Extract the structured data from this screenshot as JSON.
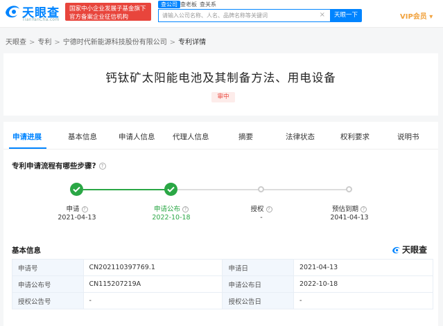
{
  "header": {
    "logo_cn": "天眼查",
    "logo_en": "TianYanCha.com",
    "promo_line1": "国家中小企业发展子基金旗下",
    "promo_line2": "官方备案企业征信机构",
    "search_tabs": [
      "查公司",
      "查老板",
      "查关系"
    ],
    "search_placeholder": "请输入公司名称、人名、品牌名称等关键词",
    "clear_glyph": "×",
    "search_button": "天眼一下",
    "vip": "VIP会员 ▾",
    "colors": {
      "brand": "#0084ff",
      "promo": "#e8453c",
      "vip": "#f1a23d"
    }
  },
  "breadcrumb": [
    "天眼查",
    "专利",
    "宁德时代新能源科技股份有限公司",
    "专利详情"
  ],
  "patent": {
    "title": "钙钛矿太阳能电池及其制备方法、用电设备",
    "status": "审中"
  },
  "tabs": [
    "申请进展",
    "基本信息",
    "申请人信息",
    "代理人信息",
    "摘要",
    "法律状态",
    "权利要求",
    "说明书"
  ],
  "progress": {
    "question": "专利申请流程有哪些步骤?",
    "steps": [
      {
        "name": "申请",
        "date": "2021-04-13",
        "done": true
      },
      {
        "name": "申请公布",
        "date": "2022-10-18",
        "done": true
      },
      {
        "name": "授权",
        "date": "-",
        "done": false
      },
      {
        "name": "预估到期",
        "date": "2041-04-13",
        "done": false
      }
    ],
    "colors": {
      "done": "#2aa745",
      "todo": "#cccccc"
    }
  },
  "basic": {
    "title": "基本信息",
    "brand": "天眼查",
    "rows": [
      [
        "申请号",
        "CN202110397769.1",
        "申请日",
        "2021-04-13"
      ],
      [
        "申请公布号",
        "CN115207219A",
        "申请公布日",
        "2022-10-18"
      ],
      [
        "授权公告号",
        "-",
        "授权公告日",
        "-"
      ]
    ]
  }
}
